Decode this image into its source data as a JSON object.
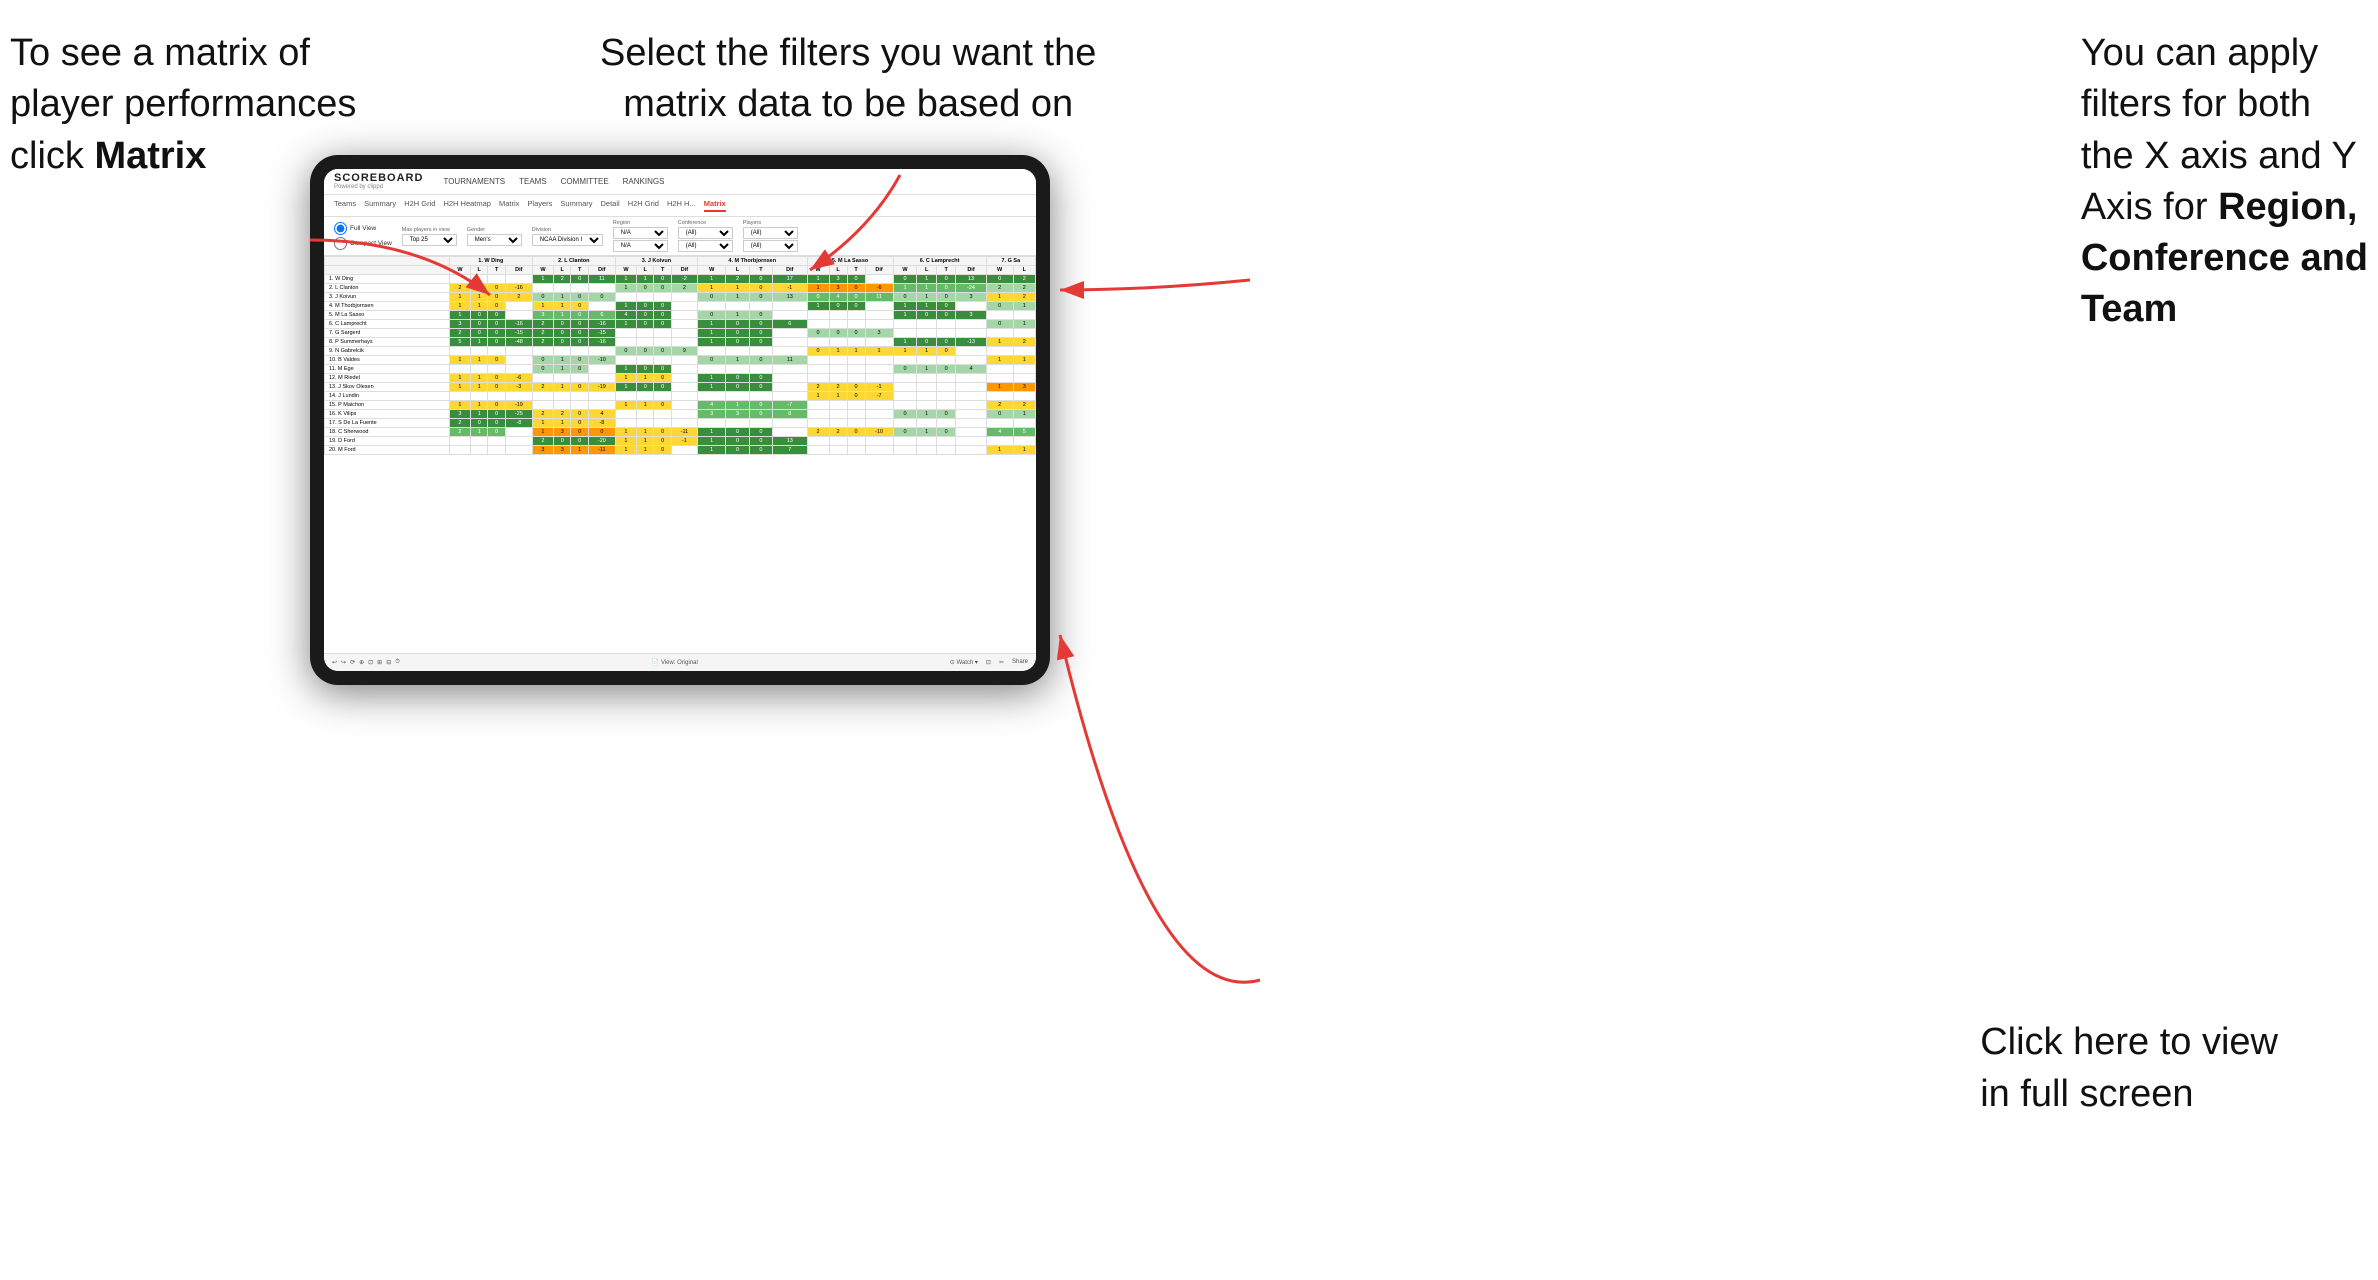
{
  "annotations": {
    "top_left": {
      "line1": "To see a matrix of",
      "line2": "player performances",
      "line3_normal": "click ",
      "line3_bold": "Matrix"
    },
    "top_center": {
      "line1": "Select the filters you want the",
      "line2": "matrix data to be based on"
    },
    "top_right": {
      "line1": "You  can apply",
      "line2": "filters for both",
      "line3": "the X axis and Y",
      "line4_normal": "Axis for ",
      "line4_bold": "Region,",
      "line5_bold": "Conference and",
      "line6_bold": "Team"
    },
    "bottom_right": {
      "line1": "Click here to view",
      "line2": "in full screen"
    }
  },
  "app": {
    "logo_title": "SCOREBOARD",
    "logo_powered": "Powered by clippd",
    "nav": [
      "TOURNAMENTS",
      "TEAMS",
      "COMMITTEE",
      "RANKINGS"
    ],
    "sub_tabs": [
      "Teams",
      "Summary",
      "H2H Grid",
      "H2H Heatmap",
      "Matrix",
      "Players",
      "Summary",
      "Detail",
      "H2H Grid",
      "H2H H...",
      "Matrix"
    ],
    "active_tab": "Matrix",
    "filters": {
      "view_options": [
        "Full View",
        "Compact View"
      ],
      "max_players_label": "Max players in view",
      "max_players_value": "Top 25",
      "gender_label": "Gender",
      "gender_value": "Men's",
      "division_label": "Division",
      "division_value": "NCAA Division I",
      "region_label": "Region",
      "region_value1": "N/A",
      "region_value2": "N/A",
      "conference_label": "Conference",
      "conference_value1": "(All)",
      "conference_value2": "(All)",
      "players_label": "Players",
      "players_value1": "(All)",
      "players_value2": "(All)"
    },
    "column_headers": [
      "1. W Ding",
      "2. L Clanton",
      "3. J Koivun",
      "4. M Thorbjornsen",
      "5. M La Sasso",
      "6. C Lamprecht",
      "7. G Sa"
    ],
    "sub_headers": [
      "W",
      "L",
      "T",
      "Dif"
    ],
    "rows": [
      {
        "name": "1. W Ding",
        "cells": [
          [
            "",
            "",
            "",
            ""
          ],
          [
            "1",
            "2",
            "0",
            "11"
          ],
          [
            "1",
            "1",
            "0",
            "-2"
          ],
          [
            "1",
            "2",
            "0",
            "17"
          ],
          [
            "1",
            "3",
            "0",
            ""
          ],
          [
            "0",
            "1",
            "0",
            "13"
          ],
          [
            "0",
            "2",
            ""
          ]
        ]
      },
      {
        "name": "2. L Clanton",
        "cells": [
          [
            "2",
            "1",
            "0",
            "-16"
          ],
          [
            "",
            "",
            "",
            ""
          ],
          [
            "1",
            "0",
            "0",
            "2"
          ],
          [
            "1",
            "1",
            "0",
            "-1"
          ],
          [
            "1",
            "3",
            "0",
            "-6"
          ],
          [
            "1",
            "1",
            "0",
            "-24"
          ],
          [
            "2",
            "2",
            ""
          ]
        ]
      },
      {
        "name": "3. J Koivun",
        "cells": [
          [
            "1",
            "1",
            "0",
            "2"
          ],
          [
            "0",
            "1",
            "0",
            "0"
          ],
          [
            "",
            "",
            "",
            ""
          ],
          [
            "0",
            "1",
            "0",
            "13"
          ],
          [
            "0",
            "4",
            "0",
            "11"
          ],
          [
            "0",
            "1",
            "0",
            "3"
          ],
          [
            "1",
            "2",
            ""
          ]
        ]
      },
      {
        "name": "4. M Thorbjornsen",
        "cells": [
          [
            "1",
            "1",
            "0",
            ""
          ],
          [
            "1",
            "1",
            "0",
            ""
          ],
          [
            "1",
            "0",
            "0",
            ""
          ],
          [
            "",
            "",
            "",
            ""
          ],
          [
            "1",
            "0",
            "0",
            ""
          ],
          [
            "1",
            "1",
            "0",
            ""
          ],
          [
            "0",
            "1",
            ""
          ]
        ]
      },
      {
        "name": "5. M La Sasso",
        "cells": [
          [
            "1",
            "0",
            "0",
            ""
          ],
          [
            "3",
            "1",
            "0",
            "6"
          ],
          [
            "4",
            "0",
            "0",
            ""
          ],
          [
            "0",
            "1",
            "0",
            ""
          ],
          [
            "",
            "",
            "",
            ""
          ],
          [
            "1",
            "0",
            "0",
            "3"
          ],
          [
            "",
            "",
            ""
          ]
        ]
      },
      {
        "name": "6. C Lamprecht",
        "cells": [
          [
            "3",
            "0",
            "0",
            "-16"
          ],
          [
            "2",
            "0",
            "0",
            "-16"
          ],
          [
            "1",
            "0",
            "0",
            ""
          ],
          [
            "1",
            "0",
            "0",
            "6"
          ],
          [
            "",
            "",
            "",
            ""
          ],
          [
            "",
            "",
            "",
            ""
          ],
          [
            "0",
            "1",
            ""
          ]
        ]
      },
      {
        "name": "7. G Sargent",
        "cells": [
          [
            "2",
            "0",
            "0",
            "-15"
          ],
          [
            "2",
            "0",
            "0",
            "-15"
          ],
          [
            "",
            "",
            "",
            ""
          ],
          [
            "1",
            "0",
            "0",
            ""
          ],
          [
            "0",
            "0",
            "0",
            "3"
          ],
          [
            "",
            "",
            "",
            ""
          ],
          [
            "",
            "",
            ""
          ]
        ]
      },
      {
        "name": "8. P Summerhays",
        "cells": [
          [
            "5",
            "1",
            "0",
            "-48"
          ],
          [
            "2",
            "0",
            "0",
            "-16"
          ],
          [
            "",
            "",
            "",
            ""
          ],
          [
            "1",
            "0",
            "0",
            ""
          ],
          [
            "",
            "",
            "",
            ""
          ],
          [
            "1",
            "0",
            "0",
            "-13"
          ],
          [
            "1",
            "2",
            ""
          ]
        ]
      },
      {
        "name": "9. N Gabrelcik",
        "cells": [
          [
            "",
            "",
            "",
            ""
          ],
          [
            "",
            "",
            "",
            ""
          ],
          [
            "0",
            "0",
            "0",
            "9"
          ],
          [
            "",
            "",
            "",
            ""
          ],
          [
            "0",
            "1",
            "1",
            "1"
          ],
          [
            "1",
            "1",
            "0",
            ""
          ],
          [
            "",
            "",
            ""
          ]
        ]
      },
      {
        "name": "10. B Valdes",
        "cells": [
          [
            "1",
            "1",
            "0",
            ""
          ],
          [
            "0",
            "1",
            "0",
            "-10"
          ],
          [
            "",
            "",
            "",
            ""
          ],
          [
            "0",
            "1",
            "0",
            "11"
          ],
          [
            "",
            "",
            "",
            ""
          ],
          [
            "",
            "",
            "",
            ""
          ],
          [
            "1",
            "1",
            ""
          ]
        ]
      },
      {
        "name": "11. M Ege",
        "cells": [
          [
            "",
            "",
            "",
            ""
          ],
          [
            "0",
            "1",
            "0",
            ""
          ],
          [
            "1",
            "0",
            "0",
            ""
          ],
          [
            "",
            "",
            "",
            ""
          ],
          [
            "",
            "",
            "",
            ""
          ],
          [
            "0",
            "1",
            "0",
            "4"
          ],
          [
            "",
            "",
            ""
          ]
        ]
      },
      {
        "name": "12. M Riedel",
        "cells": [
          [
            "1",
            "1",
            "0",
            "-6"
          ],
          [
            "",
            "",
            "",
            ""
          ],
          [
            "1",
            "1",
            "0",
            ""
          ],
          [
            "1",
            "0",
            "0",
            ""
          ],
          [
            "",
            "",
            "",
            ""
          ],
          [
            "",
            "",
            "",
            ""
          ],
          [
            "",
            "",
            ""
          ]
        ]
      },
      {
        "name": "13. J Skov Olesen",
        "cells": [
          [
            "1",
            "1",
            "0",
            "-3"
          ],
          [
            "2",
            "1",
            "0",
            "-19"
          ],
          [
            "1",
            "0",
            "0",
            ""
          ],
          [
            "1",
            "0",
            "0",
            ""
          ],
          [
            "2",
            "2",
            "0",
            "-1"
          ],
          [
            "",
            "",
            "",
            ""
          ],
          [
            "1",
            "3",
            ""
          ]
        ]
      },
      {
        "name": "14. J Lundin",
        "cells": [
          [
            "",
            "",
            "",
            ""
          ],
          [
            "",
            "",
            "",
            ""
          ],
          [
            "",
            "",
            "",
            ""
          ],
          [
            "",
            "",
            "",
            ""
          ],
          [
            "1",
            "1",
            "0",
            "-7"
          ],
          [
            "",
            "",
            "",
            ""
          ],
          [
            "",
            "",
            ""
          ]
        ]
      },
      {
        "name": "15. P Maichon",
        "cells": [
          [
            "1",
            "1",
            "0",
            "-19"
          ],
          [
            "",
            "",
            "",
            ""
          ],
          [
            "1",
            "1",
            "0",
            ""
          ],
          [
            "4",
            "1",
            "0",
            "-7"
          ],
          [
            "",
            "",
            "",
            ""
          ],
          [
            "",
            "",
            "",
            ""
          ],
          [
            "2",
            "2",
            ""
          ]
        ]
      },
      {
        "name": "16. K Vilips",
        "cells": [
          [
            "3",
            "1",
            "0",
            "-25"
          ],
          [
            "2",
            "2",
            "0",
            "4"
          ],
          [
            "",
            "",
            "",
            ""
          ],
          [
            "3",
            "3",
            "0",
            "8"
          ],
          [
            "",
            "",
            "",
            ""
          ],
          [
            "0",
            "1",
            "0",
            ""
          ],
          [
            "0",
            "1",
            ""
          ]
        ]
      },
      {
        "name": "17. S De La Fuente",
        "cells": [
          [
            "2",
            "0",
            "0",
            "-8"
          ],
          [
            "1",
            "1",
            "0",
            "-8"
          ],
          [
            "",
            "",
            "",
            ""
          ],
          [
            "",
            "",
            "",
            ""
          ],
          [
            "",
            "",
            "",
            ""
          ],
          [
            "",
            "",
            "",
            ""
          ],
          [
            "",
            "",
            ""
          ]
        ]
      },
      {
        "name": "18. C Sherwood",
        "cells": [
          [
            "2",
            "1",
            "0",
            ""
          ],
          [
            "1",
            "3",
            "0",
            "0"
          ],
          [
            "1",
            "1",
            "0",
            "-11"
          ],
          [
            "1",
            "0",
            "0",
            ""
          ],
          [
            "2",
            "2",
            "0",
            "-10"
          ],
          [
            "0",
            "1",
            "0",
            ""
          ],
          [
            "4",
            "5",
            ""
          ]
        ]
      },
      {
        "name": "19. D Ford",
        "cells": [
          [
            "",
            "",
            "",
            ""
          ],
          [
            "2",
            "0",
            "0",
            "-20"
          ],
          [
            "1",
            "1",
            "0",
            "-1"
          ],
          [
            "1",
            "0",
            "0",
            "13"
          ],
          [
            "",
            "",
            "",
            ""
          ],
          [
            "",
            "",
            "",
            ""
          ],
          [
            "",
            "",
            ""
          ]
        ]
      },
      {
        "name": "20. M Ford",
        "cells": [
          [
            "",
            "",
            "",
            ""
          ],
          [
            "3",
            "3",
            "1",
            "-11"
          ],
          [
            "1",
            "1",
            "0",
            ""
          ],
          [
            "1",
            "0",
            "0",
            "7"
          ],
          [
            "",
            "",
            "",
            ""
          ],
          [
            "",
            "",
            "",
            ""
          ],
          [
            "1",
            "1",
            ""
          ]
        ]
      }
    ],
    "bottom_toolbar": {
      "left_icons": [
        "↩",
        "↪",
        "⟳",
        "⊕",
        "⊡",
        "⊞",
        "⊟",
        "⏱"
      ],
      "center": "View: Original",
      "right": "Watch ▾  ⊡  ✂  Share"
    }
  }
}
